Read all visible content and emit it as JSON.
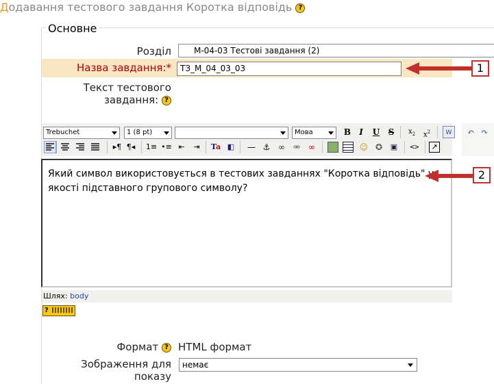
{
  "page": {
    "title_first_letter": "Д",
    "title_rest": "одавання тестового завдання Коротка відповідь"
  },
  "form": {
    "legend": "Основне",
    "section_label": "Розділ",
    "section_value": "М-04-03 Тестові завдання (2)",
    "name_label": "Назва завдання:",
    "required_mark": "*",
    "name_value": "ТЗ_М_04_03_03",
    "text_label_line1": "Текст тестового",
    "text_label_line2": "завдання:",
    "editor_text": "Який символ використовується в тестових завданнях \"Коротка відповідь\" у якості підставного групового символу?",
    "path_label": "Шлях:",
    "path_value": "body",
    "format_label": "Формат",
    "format_value": "HTML формат",
    "image_label_line1": "Зображення для",
    "image_label_line2": "показу",
    "image_value": "немає"
  },
  "toolbar": {
    "font_family": "Trebuchet",
    "font_size": "1 (8 pt)",
    "style": "",
    "language": "Мова"
  },
  "callouts": {
    "one": "1",
    "two": "2"
  },
  "colors": {
    "highlight_row": "#fbe6c4",
    "required": "#b00000",
    "callout_red": "#c0312c"
  }
}
